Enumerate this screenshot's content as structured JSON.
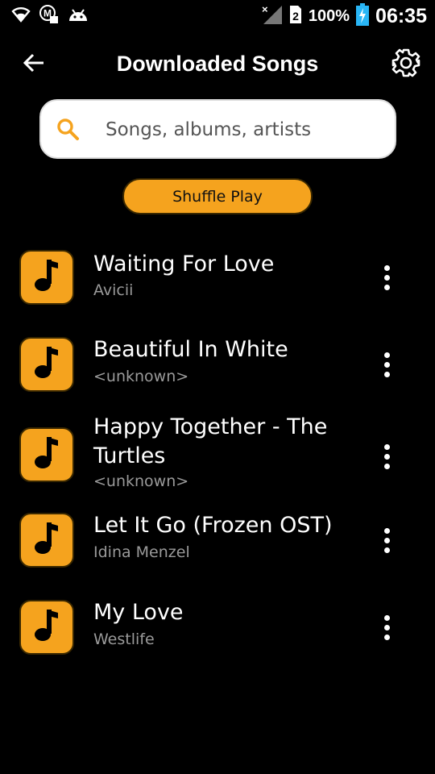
{
  "status_bar": {
    "battery": "100%",
    "time": "06:35",
    "sim_slot": "2",
    "icons": [
      "wifi-icon",
      "m-notification-icon",
      "android-debug-icon",
      "signal-off-icon",
      "sim-icon",
      "battery-charging-icon"
    ]
  },
  "app_bar": {
    "title": "Downloaded Songs",
    "back_icon": "arrow-left-icon",
    "settings_icon": "gear-icon"
  },
  "search": {
    "placeholder": "Songs, albums, artists",
    "value": ""
  },
  "shuffle": {
    "label": "Shuffle Play"
  },
  "songs": [
    {
      "title": "Waiting For Love",
      "artist": "Avicii"
    },
    {
      "title": "Beautiful In White",
      "artist": "<unknown>"
    },
    {
      "title": "Happy Together - The Turtles",
      "artist": "<unknown>"
    },
    {
      "title": "Let It Go (Frozen OST)",
      "artist": "Idina Menzel"
    },
    {
      "title": "My Love",
      "artist": "Westlife"
    }
  ],
  "colors": {
    "accent": "#f5a31e",
    "background": "#000000",
    "text_primary": "#ffffff",
    "text_secondary": "#9a9a9a"
  }
}
